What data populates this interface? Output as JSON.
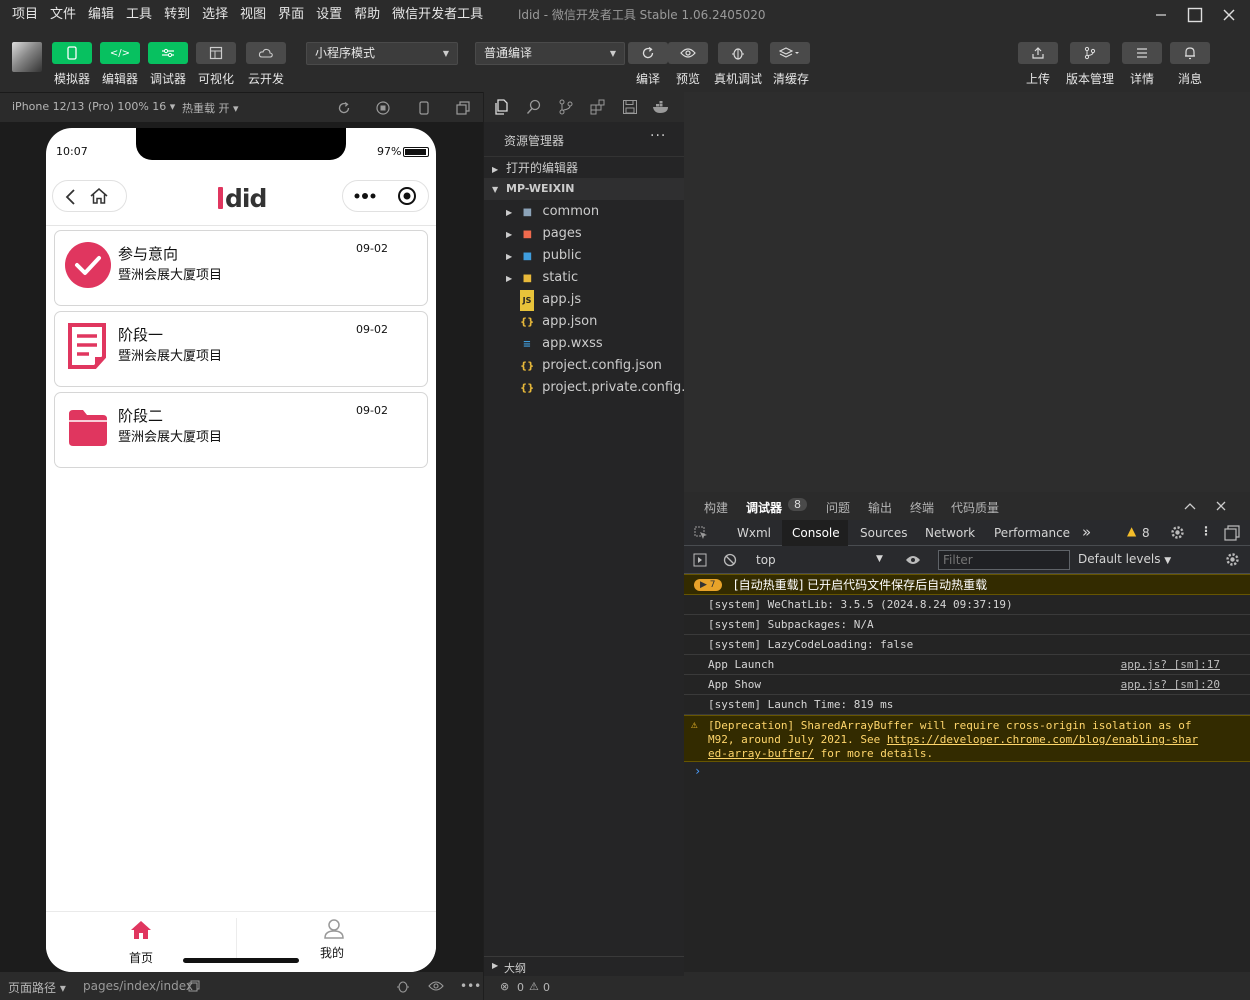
{
  "menubar": {
    "items": [
      "项目",
      "文件",
      "编辑",
      "工具",
      "转到",
      "选择",
      "视图",
      "界面",
      "设置",
      "帮助",
      "微信开发者工具"
    ],
    "window_title": "ldid - 微信开发者工具 Stable 1.06.2405020"
  },
  "toolbar": {
    "simulator": "模拟器",
    "editor": "编辑器",
    "debugger": "调试器",
    "visual": "可视化",
    "cloud": "云开发",
    "mode_select": "小程序模式",
    "compile_select": "普通编译",
    "compile": "编译",
    "preview": "预览",
    "real_debug": "真机调试",
    "clear_cache": "清缓存",
    "upload": "上传",
    "version": "版本管理",
    "details": "详情",
    "messages": "消息"
  },
  "simulator": {
    "device": "iPhone 12/13 (Pro) 100% 16",
    "hot_reload": "热重载 开",
    "time": "10:07",
    "battery": "97%",
    "battery_level": 0.97,
    "logo": "ldid",
    "cards": [
      {
        "title": "参与意向",
        "subtitle": "暨洲会展大厦项目",
        "date": "09-02"
      },
      {
        "title": "阶段一",
        "subtitle": "暨洲会展大厦项目",
        "date": "09-02"
      },
      {
        "title": "阶段二",
        "subtitle": "暨洲会展大厦项目",
        "date": "09-02"
      }
    ],
    "tabs": [
      {
        "label": "首页"
      },
      {
        "label": "我的"
      }
    ],
    "page_path_label": "页面路径",
    "page_path": "pages/index/index"
  },
  "explorer": {
    "title": "资源管理器",
    "open_editors": "打开的编辑器",
    "project": "MP-WEIXIN",
    "items": [
      {
        "name": "common",
        "type": "folder"
      },
      {
        "name": "pages",
        "type": "folder"
      },
      {
        "name": "public",
        "type": "folder"
      },
      {
        "name": "static",
        "type": "folder"
      },
      {
        "name": "app.js",
        "type": "js"
      },
      {
        "name": "app.json",
        "type": "json"
      },
      {
        "name": "app.wxss",
        "type": "wxss"
      },
      {
        "name": "project.config.json",
        "type": "json"
      },
      {
        "name": "project.private.config.j...",
        "type": "json"
      }
    ],
    "outline": "大纲",
    "errors": "0",
    "warnings": "0"
  },
  "debugger": {
    "tabs": [
      "构建",
      "调试器",
      "问题",
      "输出",
      "终端",
      "代码质量"
    ],
    "badge": "8",
    "devtools_tabs": [
      "Wxml",
      "Console",
      "Sources",
      "Network",
      "Performance"
    ],
    "warn_count": "8",
    "context": "top",
    "filter_placeholder": "Filter",
    "levels": "Default levels",
    "logs": [
      {
        "text": "[自动热重载] 已开启代码文件保存后自动热重载",
        "badge": "7",
        "type": "highlight"
      },
      {
        "text": "[system] WeChatLib: 3.5.5 (2024.8.24 09:37:19)",
        "type": "info"
      },
      {
        "text": "[system] Subpackages: N/A",
        "type": "info"
      },
      {
        "text": "[system] LazyCodeLoading: false",
        "type": "info"
      },
      {
        "text": "App Launch",
        "src": "app.js? [sm]:17",
        "type": "info"
      },
      {
        "text": "App Show",
        "src": "app.js? [sm]:20",
        "type": "info"
      },
      {
        "text": "[system] Launch Time: 819 ms",
        "type": "info"
      }
    ],
    "deprecation": {
      "line1": "[Deprecation] SharedArrayBuffer will require cross-origin isolation as of",
      "line2_prefix": "M92, around July 2021. See ",
      "link1": "https://developer.chrome.com/blog/enabling-shar",
      "link2": "ed-array-buffer/",
      "suffix": " for more details."
    }
  },
  "colors": {
    "accent": "#07c160",
    "brand": "#e0365f"
  }
}
